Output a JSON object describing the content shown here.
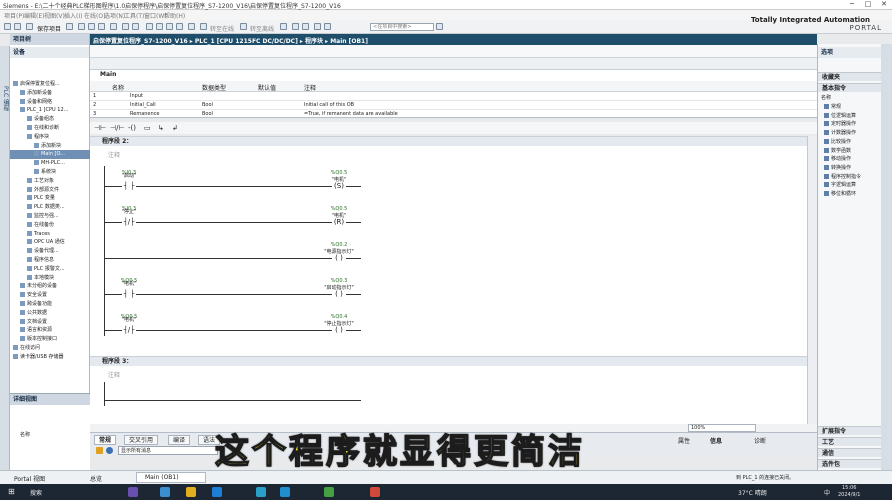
{
  "window": {
    "title": "Siemens  -  E:\\二十个经典PLC梯形图程序\\1.0启保停程序\\启保停置复位程序_S7-1200_V16\\启保停置复位程序_S7-1200_V16"
  },
  "menu": [
    "项目(P)",
    "编辑(E)",
    "视图(V)",
    "插入(I)",
    "在线(O)",
    "选项(N)",
    "工具(T)",
    "窗口(W)",
    "帮助(H)"
  ],
  "toolbar": {
    "save": "保存项目",
    "online": "转至在线",
    "offline": "转至离线",
    "search_placeholder": "<在项目中搜索>"
  },
  "brand": {
    "line1": "Totally Integrated Automation",
    "line2": "PORTAL"
  },
  "left_strip": "PLC 编程",
  "project": {
    "header": "项目树",
    "device_label": "设备",
    "tree": [
      {
        "label": "启保停置复位程...",
        "indent": 0
      },
      {
        "label": "添加新设备",
        "indent": 1
      },
      {
        "label": "设备和网络",
        "indent": 1
      },
      {
        "label": "PLC_1 [CPU 12...",
        "indent": 1
      },
      {
        "label": "设备组态",
        "indent": 2
      },
      {
        "label": "在线和诊断",
        "indent": 2
      },
      {
        "label": "程序块",
        "indent": 2
      },
      {
        "label": "添加新块",
        "indent": 3
      },
      {
        "label": "Main [O...",
        "indent": 3,
        "selected": true
      },
      {
        "label": "MH-PLC...",
        "indent": 3
      },
      {
        "label": "系统块",
        "indent": 3
      },
      {
        "label": "工艺对象",
        "indent": 2
      },
      {
        "label": "外部源文件",
        "indent": 2
      },
      {
        "label": "PLC 变量",
        "indent": 2
      },
      {
        "label": "PLC 数据类...",
        "indent": 2
      },
      {
        "label": "监控与强...",
        "indent": 2
      },
      {
        "label": "在线备份",
        "indent": 2
      },
      {
        "label": "Traces",
        "indent": 2
      },
      {
        "label": "OPC UA 通信",
        "indent": 2
      },
      {
        "label": "设备代理...",
        "indent": 2
      },
      {
        "label": "程序信息",
        "indent": 2
      },
      {
        "label": "PLC 报警文...",
        "indent": 2
      },
      {
        "label": "本地模块",
        "indent": 2
      },
      {
        "label": "未分组的设备",
        "indent": 1
      },
      {
        "label": "安全设置",
        "indent": 1
      },
      {
        "label": "跨设备功能",
        "indent": 1
      },
      {
        "label": "公共数据",
        "indent": 1
      },
      {
        "label": "文档设置",
        "indent": 1
      },
      {
        "label": "语言和资源",
        "indent": 1
      },
      {
        "label": "版本控制接口",
        "indent": 1
      },
      {
        "label": "在线访问",
        "indent": 0
      },
      {
        "label": "读卡器/USB 存储器",
        "indent": 0
      }
    ],
    "details": "详细视图",
    "details_col": "名称"
  },
  "editor": {
    "breadcrumb": "启保停置复位程序_S7-1200_V16  ▸  PLC_1 [CPU 1215FC DC/DC/DC]  ▸  程序块  ▸  Main [OB1]",
    "block": "Main",
    "iface_cols": [
      "名称",
      "数据类型",
      "默认值",
      "注释"
    ],
    "iface_rows": [
      {
        "num": "1",
        "name": "Input",
        "type": "",
        "comment": ""
      },
      {
        "num": "2",
        "name": "Initial_Call",
        "type": "Bool",
        "comment": "Initial call of this OB"
      },
      {
        "num": "3",
        "name": "Remanence",
        "type": "Bool",
        "comment": "=True, if remanent data are available"
      }
    ],
    "net2": "程序段 2：",
    "net3": "程序段 3：",
    "comment": "注释",
    "contacts": [
      {
        "addr": "%I0.3",
        "name": "\"启动\"",
        "sym": "┤ ├"
      },
      {
        "addr": "%I0.3",
        "name": "\"停止\"",
        "sym": "┤/├"
      },
      {
        "addr": "%Q0.5",
        "name": "\"电机\"",
        "sym": "┤ ├"
      },
      {
        "addr": "%Q0.5",
        "name": "\"电机\"",
        "sym": "┤/├"
      }
    ],
    "coils": [
      {
        "addr": "%Q0.5",
        "name": "\"电机\"",
        "sym": "(S)"
      },
      {
        "addr": "%Q0.5",
        "name": "\"电机\"",
        "sym": "(R)"
      },
      {
        "addr": "%Q0.2",
        "name": "\"电源指示灯\"",
        "sym": "( )"
      },
      {
        "addr": "%Q0.3",
        "name": "\"启动指示灯\"",
        "sym": "( )"
      },
      {
        "addr": "%Q0.4",
        "name": "\"停止指示灯\"",
        "sym": "( )"
      }
    ],
    "zoom": "100%"
  },
  "props": {
    "tabs": [
      "常规",
      "交叉引用",
      "编译",
      "语法"
    ],
    "filter": "显示所有消息",
    "right_tabs": [
      "属性",
      "信息",
      "诊断"
    ]
  },
  "caption": "这个程序就显得更简洁",
  "right": {
    "header": "选项",
    "fav": "收藏夹",
    "basic": "基本指令",
    "name_col": "名称",
    "items": [
      "常规",
      "位逻辑运算",
      "定时器操作",
      "计数器操作",
      "比较操作",
      "数学函数",
      "移动操作",
      "转换操作",
      "程序控制指令",
      "字逻辑运算",
      "移位和循环"
    ],
    "bottom": [
      "扩展指令",
      "工艺",
      "通信",
      "选件包"
    ]
  },
  "portal": {
    "view": "Portal 视图",
    "overview": "总览",
    "main_tab": "Main (OB1)",
    "status": "到 PLC_1 的连接已关闭。"
  },
  "taskbar": {
    "search": "搜索",
    "weather": "37°C 晴朗",
    "time": "15:06",
    "date": "2024/9/1",
    "lang": "中"
  }
}
